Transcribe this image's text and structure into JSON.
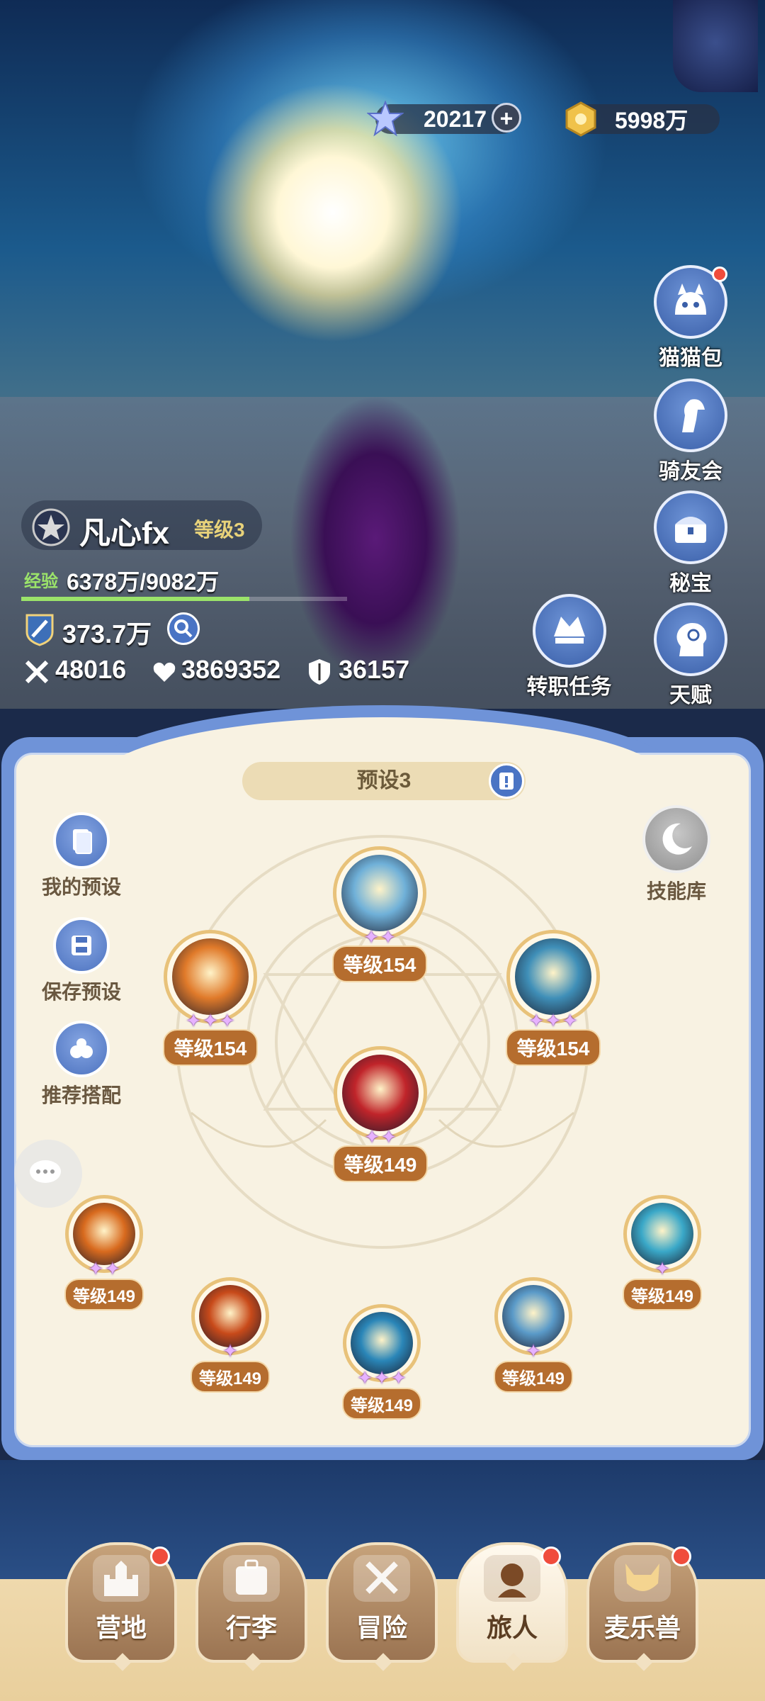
{
  "currency": {
    "gems": "20217",
    "gold": "5998万"
  },
  "side_menu": [
    {
      "label": "猫猫包",
      "icon": "cat-bag-icon",
      "badge": true
    },
    {
      "label": "骑友会",
      "icon": "horse-icon",
      "badge": false
    },
    {
      "label": "秘宝",
      "icon": "treasure-icon",
      "badge": false
    },
    {
      "label": "天赋",
      "icon": "talent-icon",
      "badge": false
    }
  ],
  "job_quest": {
    "label": "转职任务"
  },
  "player": {
    "name": "凡心fx",
    "level": "等级3",
    "exp_label": "经验",
    "exp": "6378万/9082万",
    "exp_progress": 0.7,
    "power": "373.7万",
    "attack": "48016",
    "hp": "3869352",
    "defense": "36157"
  },
  "panel": {
    "preset_title": "预设3",
    "left_buttons": [
      {
        "label": "我的预设",
        "icon": "my-preset-icon"
      },
      {
        "label": "保存预设",
        "icon": "save-icon"
      },
      {
        "label": "推荐搭配",
        "icon": "recommend-icon"
      }
    ],
    "skill_library": "技能库"
  },
  "skills": [
    {
      "level": "等级154",
      "stars": 2,
      "color": "#6fb0d8"
    },
    {
      "level": "等级154",
      "stars": 3,
      "color": "#e07a2a"
    },
    {
      "level": "等级154",
      "stars": 3,
      "color": "#3f8fb8"
    },
    {
      "level": "等级149",
      "stars": 2,
      "color": "#c0242a"
    },
    {
      "level": "等级149",
      "stars": 2,
      "color": "#d86a1e"
    },
    {
      "level": "等级149",
      "stars": 1,
      "color": "#c84a1a"
    },
    {
      "level": "等级149",
      "stars": 3,
      "color": "#2a86b8"
    },
    {
      "level": "等级149",
      "stars": 1,
      "color": "#5a9ac8"
    },
    {
      "level": "等级149",
      "stars": 1,
      "color": "#3aa8c8"
    }
  ],
  "nav": [
    {
      "label": "营地",
      "icon": "castle-icon",
      "badge": true,
      "active": false
    },
    {
      "label": "行李",
      "icon": "backpack-icon",
      "badge": false,
      "active": false
    },
    {
      "label": "冒险",
      "icon": "crossed-swords-icon",
      "badge": false,
      "active": false
    },
    {
      "label": "旅人",
      "icon": "traveler-icon",
      "badge": true,
      "active": true
    },
    {
      "label": "麦乐兽",
      "icon": "pet-icon",
      "badge": true,
      "active": false
    }
  ]
}
